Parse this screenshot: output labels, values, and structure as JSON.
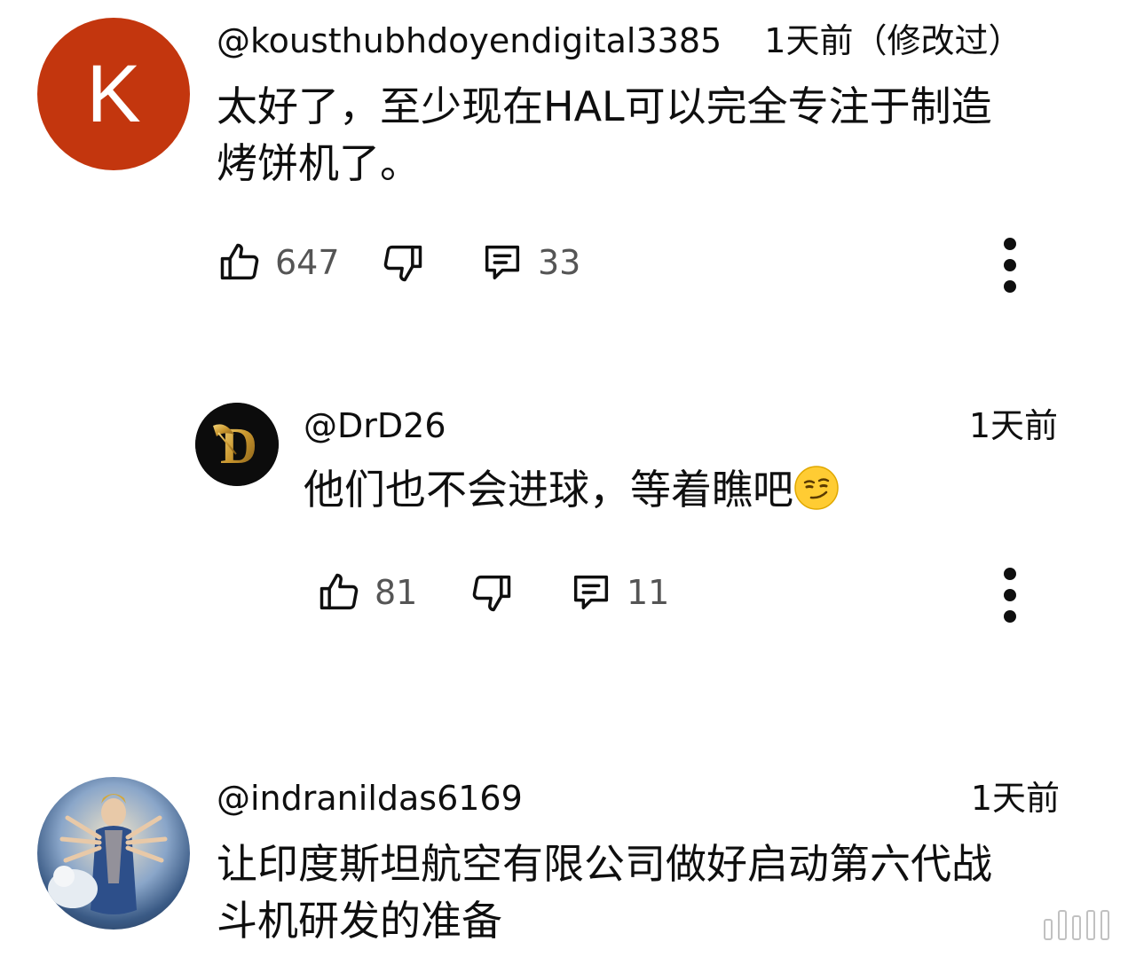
{
  "comments": [
    {
      "author": "@kousthubhdoyendigital3385",
      "timestamp": "1天前（修改过）",
      "avatar_letter": "K",
      "avatar_color": "#c3360e",
      "lines": [
        "太好了，至少现在HAL可以完全专注于制造",
        "烤饼机了。"
      ],
      "likes": "647",
      "replies": "33"
    },
    {
      "author": "@DrD26",
      "timestamp": "1天前",
      "avatar_letter": "D",
      "text": "他们也不会进球，等着瞧吧",
      "emoji": "smirking-face",
      "likes": "81",
      "replies": "11"
    },
    {
      "author": "@indranildas6169",
      "timestamp": "1天前",
      "lines": [
        "让印度斯坦航空有限公司做好启动第六代战",
        "斗机研发的准备"
      ]
    }
  ],
  "icons": {
    "like": "thumbs-up-icon",
    "dislike": "thumbs-down-icon",
    "reply": "comment-icon",
    "more": "more-vert-icon"
  },
  "colors": {
    "text": "#0f0f0f",
    "secondary": "#555555",
    "background": "#ffffff"
  }
}
